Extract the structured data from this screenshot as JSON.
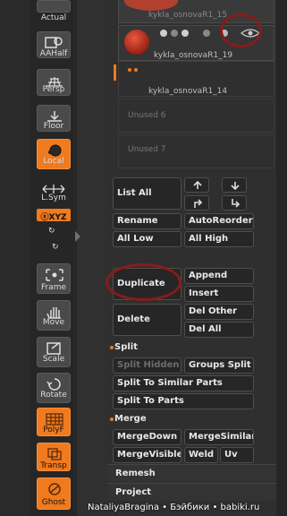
{
  "toolbar": {
    "actual": "Actual",
    "aahalf": "AAHalf",
    "persp": "Persp",
    "floor": "Floor",
    "local": "Local",
    "lsym": "L.Sym",
    "xyz": "ⓧXYZ",
    "frame": "Frame",
    "move": "Move",
    "scale": "Scale",
    "rotate": "Rotate",
    "polyf": "PolyF",
    "transp": "Transp",
    "ghost": "Ghost"
  },
  "subtools": {
    "item1_name": "kykla_osnovaR1_15",
    "item2_name": "kykla_osnovaR1_19",
    "item3_name": "kykla_osnovaR1_14",
    "unused6": "Unused 6",
    "unused7": "Unused 7"
  },
  "buttons": {
    "list_all": "List All",
    "rename": "Rename",
    "autoreorder": "AutoReorder",
    "all_low": "All Low",
    "all_high": "All High",
    "duplicate": "Duplicate",
    "append": "Append",
    "insert": "Insert",
    "delete": "Delete",
    "del_other": "Del Other",
    "del_all": "Del All"
  },
  "split": {
    "title": "Split",
    "split_hidden": "Split Hidden",
    "groups_split": "Groups Split",
    "split_similar": "Split To Similar Parts",
    "split_parts": "Split To Parts"
  },
  "merge": {
    "title": "Merge",
    "mergedown": "MergeDown",
    "mergesimilar": "MergeSimilar",
    "mergevisible": "MergeVisible",
    "weld": "Weld",
    "uv": "Uv"
  },
  "remesh": "Remesh",
  "project": "Project",
  "watermark": "NataliyaBragina • Бэйбики • babiki.ru",
  "colors": {
    "accent": "#f07a1e",
    "annotation": "#8b1a1a"
  }
}
